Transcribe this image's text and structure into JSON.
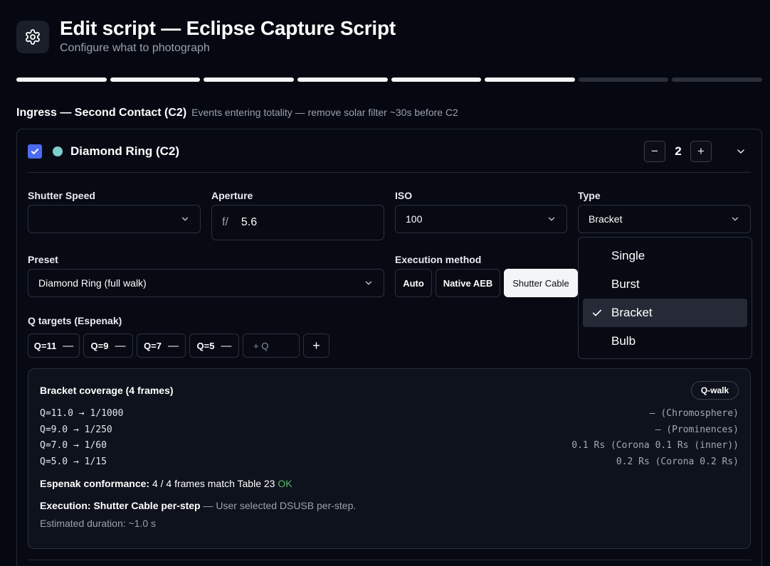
{
  "header": {
    "title": "Edit script — Eclipse Capture Script",
    "subtitle": "Configure what to photograph",
    "icon": "gear-icon"
  },
  "progress": {
    "total_steps": 8,
    "completed_steps": 6
  },
  "section": {
    "title": "Ingress — Second Contact (C2)",
    "note": "Events entering totality — remove solar filter ~30s before C2"
  },
  "item": {
    "enabled": true,
    "name": "Diamond Ring (C2)",
    "dot_color": "#7ecfcf",
    "count": "2",
    "decrement_label": "−",
    "increment_label": "+"
  },
  "fields": {
    "shutter_speed": {
      "label": "Shutter Speed",
      "value": ""
    },
    "aperture": {
      "label": "Aperture",
      "prefix": "f/",
      "value": "5.6"
    },
    "iso": {
      "label": "ISO",
      "value": "100"
    },
    "type": {
      "label": "Type",
      "value": "Bracket"
    },
    "preset": {
      "label": "Preset",
      "value": "Diamond Ring (full walk)"
    }
  },
  "execution": {
    "label": "Execution method",
    "options": [
      "Auto",
      "Native AEB",
      "Shutter Cable"
    ],
    "selected": "Shutter Cable"
  },
  "q_targets": {
    "label": "Q targets (Espenak)",
    "chips": [
      "Q=11",
      "Q=9",
      "Q=7",
      "Q=5"
    ],
    "remove_glyph": "—",
    "input_placeholder": "+ Q",
    "add_label": "+"
  },
  "coverage": {
    "title": "Bracket coverage (4 frames)",
    "badge": "Q-walk",
    "rows": [
      {
        "left": "Q=11.0 → 1/1000",
        "right": "— (Chromosphere)"
      },
      {
        "left": "Q=9.0 → 1/250",
        "right": "— (Prominences)"
      },
      {
        "left": "Q=7.0 → 1/60",
        "right": "0.1 Rs (Corona 0.1 Rs (inner))"
      },
      {
        "left": "Q=5.0 → 1/15",
        "right": "0.2 Rs (Corona 0.2 Rs)"
      }
    ],
    "conformance_label": "Espenak conformance:",
    "conformance_value": "4 / 4 frames match Table 23",
    "conformance_status": "OK",
    "execution_label": "Execution:",
    "execution_value": "Shutter Cable per-step",
    "execution_note": "— User selected DSUSB per-step.",
    "duration": "Estimated duration: ~1.0 s"
  },
  "type_dropdown": {
    "options": [
      "Single",
      "Burst",
      "Bracket",
      "Bulb"
    ],
    "selected": "Bracket"
  },
  "colors": {
    "background": "#050811",
    "accent": "#4c6bf0",
    "ok": "#57b86a"
  }
}
